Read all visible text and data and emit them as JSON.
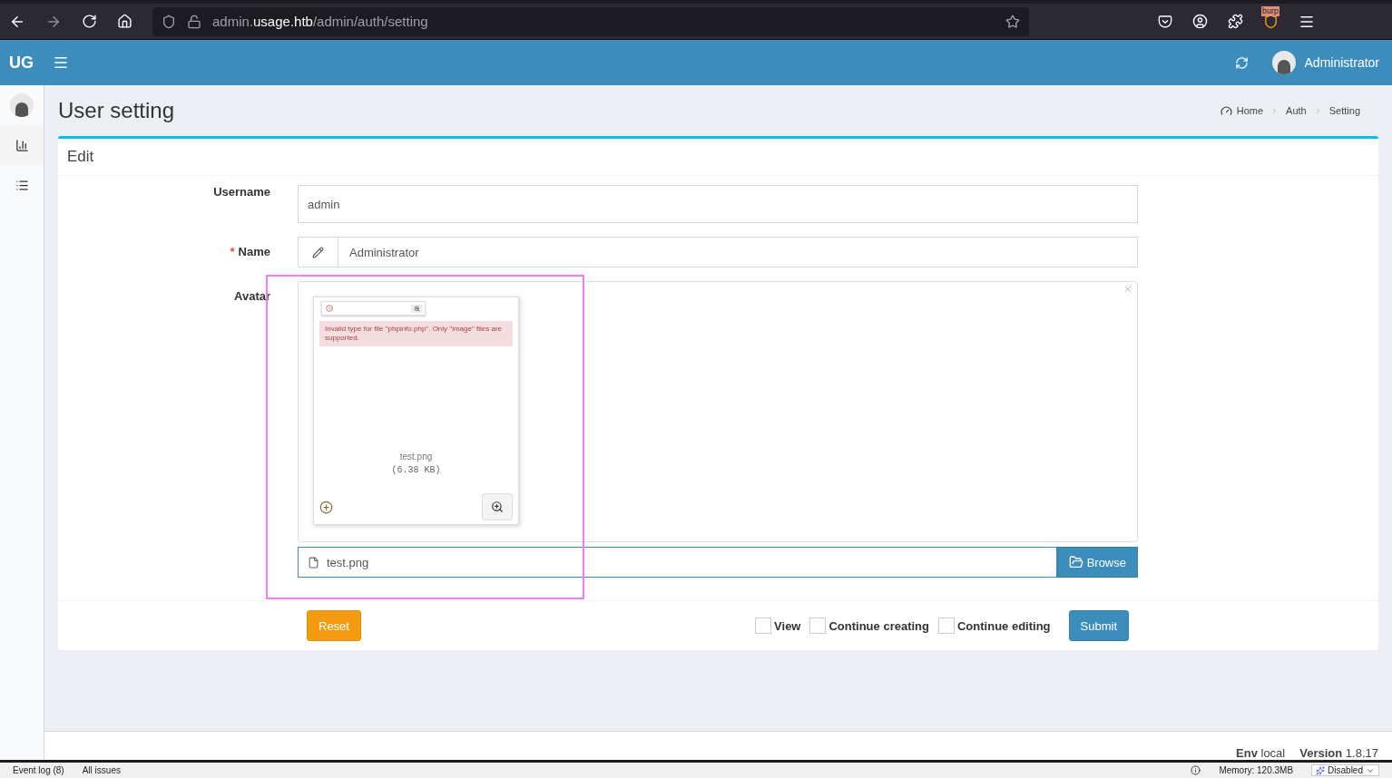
{
  "browser": {
    "url_sub": "admin.",
    "url_host": "usage.htb",
    "url_path": "/admin/auth/setting",
    "extension_badge": "burp"
  },
  "header": {
    "logo": "UG",
    "user": "Administrator"
  },
  "page": {
    "title": "User setting",
    "breadcrumb": [
      "Home",
      "Auth",
      "Setting"
    ]
  },
  "form": {
    "title": "Edit",
    "fields": [
      {
        "kind": "text",
        "label": "Username",
        "value": "admin"
      },
      {
        "kind": "icon-text",
        "label": "Name",
        "required_mark": "*",
        "value": "Administrator"
      },
      {
        "kind": "file",
        "label": "Avatar",
        "preview": {
          "error": "Invalid type for file \"phpinfo.php\". Only \"image\" files are supported.",
          "file_name": "test.png",
          "file_size": "(6.38 KB)"
        },
        "value": "test.png",
        "browse": "Browse"
      }
    ],
    "reset": "Reset",
    "options": [
      {
        "label": "View",
        "checked": false
      },
      {
        "label": "Continue creating",
        "checked": false
      },
      {
        "label": "Continue editing",
        "checked": false
      }
    ],
    "submit": "Submit"
  },
  "footer": {
    "env_label": "Env",
    "env": "local",
    "version_label": "Version",
    "version": "1.8.17"
  },
  "devbar": {
    "tabs": [
      "Event log (8)",
      "All issues"
    ],
    "memory": "Memory: 120.3MB",
    "mode": "Disabled"
  }
}
